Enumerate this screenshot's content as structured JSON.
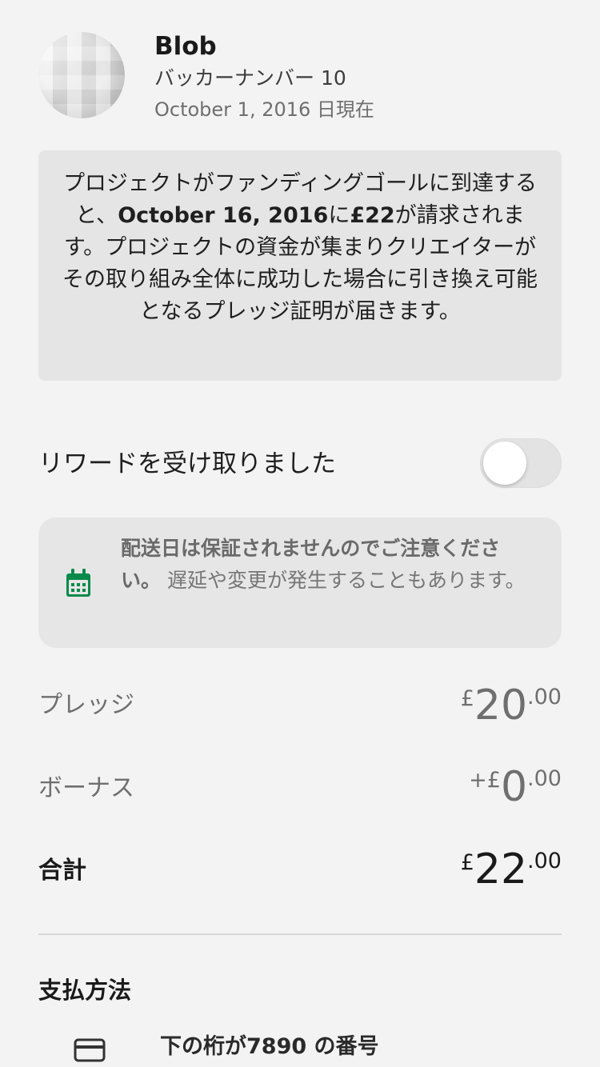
{
  "backer": {
    "name": "Blob",
    "number": "バッカーナンバー 10",
    "as_of": "October 1, 2016 日現在"
  },
  "notice": {
    "text_before": "プロジェクトがファンディングゴールに到達すると、",
    "date": "October 16, 2016",
    "text_middle": "に",
    "amount": "£22",
    "text_after": "が請求されます。プロジェクトの資金が集まりクリエイターがその取り組み全体に成功した場合に引き換え可能となるプレッジ証明が届きます。"
  },
  "reward": {
    "label": "リワードを受け取りました",
    "received": false
  },
  "shipping": {
    "strong_text": "配送日は保証されませんのでご注意ください。",
    "text": " 遅延や変更が発生することもあります。",
    "icon": "calendar-icon",
    "icon_color": "#0a8a4a"
  },
  "amounts": {
    "pledge": {
      "label": "プレッジ",
      "prefix": "£",
      "whole": "20",
      "fraction": ".00"
    },
    "bonus": {
      "label": "ボーナス",
      "prefix": "+£",
      "whole": "0",
      "fraction": ".00"
    },
    "total": {
      "label": "合計",
      "prefix": "£",
      "whole": "22",
      "fraction": ".00"
    }
  },
  "payment": {
    "title": "支払方法",
    "card_text": "下の桁が7890 の番号",
    "icon": "credit-card-icon"
  }
}
